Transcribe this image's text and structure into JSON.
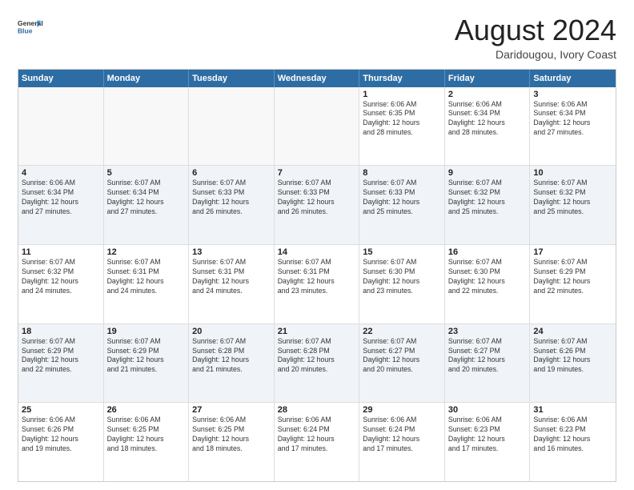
{
  "logo": {
    "line1": "General",
    "line2": "Blue"
  },
  "title": "August 2024",
  "subtitle": "Daridougou, Ivory Coast",
  "header_days": [
    "Sunday",
    "Monday",
    "Tuesday",
    "Wednesday",
    "Thursday",
    "Friday",
    "Saturday"
  ],
  "rows": [
    [
      {
        "day": "",
        "info": "",
        "empty": true
      },
      {
        "day": "",
        "info": "",
        "empty": true
      },
      {
        "day": "",
        "info": "",
        "empty": true
      },
      {
        "day": "",
        "info": "",
        "empty": true
      },
      {
        "day": "1",
        "info": "Sunrise: 6:06 AM\nSunset: 6:35 PM\nDaylight: 12 hours\nand 28 minutes."
      },
      {
        "day": "2",
        "info": "Sunrise: 6:06 AM\nSunset: 6:34 PM\nDaylight: 12 hours\nand 28 minutes."
      },
      {
        "day": "3",
        "info": "Sunrise: 6:06 AM\nSunset: 6:34 PM\nDaylight: 12 hours\nand 27 minutes."
      }
    ],
    [
      {
        "day": "4",
        "info": "Sunrise: 6:06 AM\nSunset: 6:34 PM\nDaylight: 12 hours\nand 27 minutes."
      },
      {
        "day": "5",
        "info": "Sunrise: 6:07 AM\nSunset: 6:34 PM\nDaylight: 12 hours\nand 27 minutes."
      },
      {
        "day": "6",
        "info": "Sunrise: 6:07 AM\nSunset: 6:33 PM\nDaylight: 12 hours\nand 26 minutes."
      },
      {
        "day": "7",
        "info": "Sunrise: 6:07 AM\nSunset: 6:33 PM\nDaylight: 12 hours\nand 26 minutes."
      },
      {
        "day": "8",
        "info": "Sunrise: 6:07 AM\nSunset: 6:33 PM\nDaylight: 12 hours\nand 25 minutes."
      },
      {
        "day": "9",
        "info": "Sunrise: 6:07 AM\nSunset: 6:32 PM\nDaylight: 12 hours\nand 25 minutes."
      },
      {
        "day": "10",
        "info": "Sunrise: 6:07 AM\nSunset: 6:32 PM\nDaylight: 12 hours\nand 25 minutes."
      }
    ],
    [
      {
        "day": "11",
        "info": "Sunrise: 6:07 AM\nSunset: 6:32 PM\nDaylight: 12 hours\nand 24 minutes."
      },
      {
        "day": "12",
        "info": "Sunrise: 6:07 AM\nSunset: 6:31 PM\nDaylight: 12 hours\nand 24 minutes."
      },
      {
        "day": "13",
        "info": "Sunrise: 6:07 AM\nSunset: 6:31 PM\nDaylight: 12 hours\nand 24 minutes."
      },
      {
        "day": "14",
        "info": "Sunrise: 6:07 AM\nSunset: 6:31 PM\nDaylight: 12 hours\nand 23 minutes."
      },
      {
        "day": "15",
        "info": "Sunrise: 6:07 AM\nSunset: 6:30 PM\nDaylight: 12 hours\nand 23 minutes."
      },
      {
        "day": "16",
        "info": "Sunrise: 6:07 AM\nSunset: 6:30 PM\nDaylight: 12 hours\nand 22 minutes."
      },
      {
        "day": "17",
        "info": "Sunrise: 6:07 AM\nSunset: 6:29 PM\nDaylight: 12 hours\nand 22 minutes."
      }
    ],
    [
      {
        "day": "18",
        "info": "Sunrise: 6:07 AM\nSunset: 6:29 PM\nDaylight: 12 hours\nand 22 minutes."
      },
      {
        "day": "19",
        "info": "Sunrise: 6:07 AM\nSunset: 6:29 PM\nDaylight: 12 hours\nand 21 minutes."
      },
      {
        "day": "20",
        "info": "Sunrise: 6:07 AM\nSunset: 6:28 PM\nDaylight: 12 hours\nand 21 minutes."
      },
      {
        "day": "21",
        "info": "Sunrise: 6:07 AM\nSunset: 6:28 PM\nDaylight: 12 hours\nand 20 minutes."
      },
      {
        "day": "22",
        "info": "Sunrise: 6:07 AM\nSunset: 6:27 PM\nDaylight: 12 hours\nand 20 minutes."
      },
      {
        "day": "23",
        "info": "Sunrise: 6:07 AM\nSunset: 6:27 PM\nDaylight: 12 hours\nand 20 minutes."
      },
      {
        "day": "24",
        "info": "Sunrise: 6:07 AM\nSunset: 6:26 PM\nDaylight: 12 hours\nand 19 minutes."
      }
    ],
    [
      {
        "day": "25",
        "info": "Sunrise: 6:06 AM\nSunset: 6:26 PM\nDaylight: 12 hours\nand 19 minutes."
      },
      {
        "day": "26",
        "info": "Sunrise: 6:06 AM\nSunset: 6:25 PM\nDaylight: 12 hours\nand 18 minutes."
      },
      {
        "day": "27",
        "info": "Sunrise: 6:06 AM\nSunset: 6:25 PM\nDaylight: 12 hours\nand 18 minutes."
      },
      {
        "day": "28",
        "info": "Sunrise: 6:06 AM\nSunset: 6:24 PM\nDaylight: 12 hours\nand 17 minutes."
      },
      {
        "day": "29",
        "info": "Sunrise: 6:06 AM\nSunset: 6:24 PM\nDaylight: 12 hours\nand 17 minutes."
      },
      {
        "day": "30",
        "info": "Sunrise: 6:06 AM\nSunset: 6:23 PM\nDaylight: 12 hours\nand 17 minutes."
      },
      {
        "day": "31",
        "info": "Sunrise: 6:06 AM\nSunset: 6:23 PM\nDaylight: 12 hours\nand 16 minutes."
      }
    ]
  ]
}
